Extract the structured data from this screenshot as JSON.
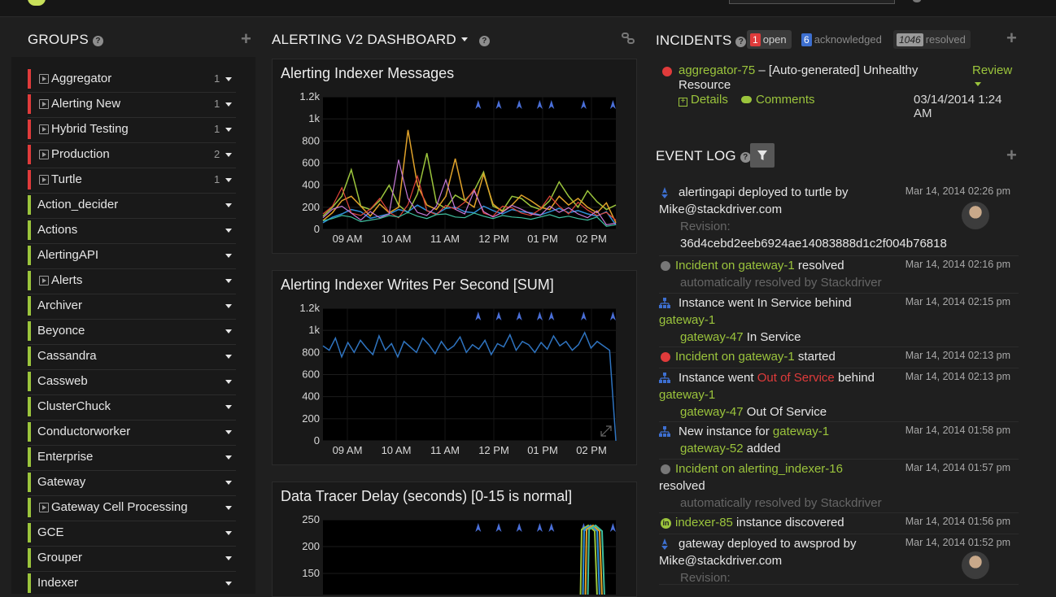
{
  "colors": {
    "accent_green": "#9bc43c",
    "alert_red": "#e03b3b",
    "chart_blue": "#2f74c0",
    "bg": "#1f1f1f"
  },
  "groups": {
    "title": "GROUPS",
    "items": [
      {
        "label": "Aggregator",
        "count": "1",
        "status": "red",
        "has_play": true
      },
      {
        "label": "Alerting New",
        "count": "1",
        "status": "red",
        "has_play": true
      },
      {
        "label": "Hybrid Testing",
        "count": "1",
        "status": "red",
        "has_play": true
      },
      {
        "label": "Production",
        "count": "2",
        "status": "red",
        "has_play": true
      },
      {
        "label": "Turtle",
        "count": "1",
        "status": "red",
        "has_play": true
      },
      {
        "label": "Action_decider",
        "count": "",
        "status": "green",
        "has_play": false
      },
      {
        "label": "Actions",
        "count": "",
        "status": "green",
        "has_play": false
      },
      {
        "label": "AlertingAPI",
        "count": "",
        "status": "green",
        "has_play": false
      },
      {
        "label": "Alerts",
        "count": "",
        "status": "green",
        "has_play": true
      },
      {
        "label": "Archiver",
        "count": "",
        "status": "green",
        "has_play": false
      },
      {
        "label": "Beyonce",
        "count": "",
        "status": "green",
        "has_play": false
      },
      {
        "label": "Cassandra",
        "count": "",
        "status": "green",
        "has_play": false
      },
      {
        "label": "Cassweb",
        "count": "",
        "status": "green",
        "has_play": false
      },
      {
        "label": "ClusterChuck",
        "count": "",
        "status": "green",
        "has_play": false
      },
      {
        "label": "Conductorworker",
        "count": "",
        "status": "green",
        "has_play": false
      },
      {
        "label": "Enterprise",
        "count": "",
        "status": "green",
        "has_play": false
      },
      {
        "label": "Gateway",
        "count": "",
        "status": "green",
        "has_play": false
      },
      {
        "label": "Gateway Cell Processing",
        "count": "",
        "status": "green",
        "has_play": true
      },
      {
        "label": "GCE",
        "count": "",
        "status": "green",
        "has_play": false
      },
      {
        "label": "Grouper",
        "count": "",
        "status": "green",
        "has_play": false
      },
      {
        "label": "Indexer",
        "count": "",
        "status": "green",
        "has_play": false
      }
    ]
  },
  "dashboard": {
    "title": "ALERTING V2 DASHBOARD",
    "charts": [
      {
        "title": "Alerting Indexer Messages"
      },
      {
        "title": "Alerting Indexer Writes Per Second [SUM]"
      },
      {
        "title": "Data Tracer Delay (seconds) [0-15 is normal]"
      }
    ]
  },
  "chart_data": [
    {
      "type": "line",
      "title": "Alerting Indexer Messages",
      "stacked_multicolor": true,
      "x": [
        "09 AM",
        "10 AM",
        "11 AM",
        "12 PM",
        "01 PM",
        "02 PM"
      ],
      "yticks": [
        "1.2k",
        "1k",
        "800",
        "600",
        "400",
        "200",
        "0"
      ],
      "ylim": [
        0,
        1200
      ],
      "series_colors": [
        "#9bc43c",
        "#e0a22a",
        "#2f8fd8",
        "#e0443a",
        "#c77ad8",
        "#3fbf9f"
      ],
      "series": [
        {
          "values": [
            120,
            200,
            300,
            540,
            210,
            180,
            260,
            400,
            220,
            150,
            320,
            690,
            240,
            190,
            310,
            260,
            350,
            520,
            210,
            170,
            300,
            280,
            210,
            180,
            260,
            430,
            300,
            200,
            350,
            250,
            180,
            220
          ]
        },
        {
          "values": [
            80,
            150,
            260,
            300,
            210,
            120,
            230,
            150,
            200,
            900,
            400,
            220,
            180,
            300,
            640,
            260,
            200,
            500,
            230,
            160,
            220,
            310,
            260,
            200,
            180,
            300,
            220,
            280,
            200,
            150,
            240,
            60
          ]
        },
        {
          "values": [
            60,
            110,
            140,
            180,
            160,
            100,
            120,
            140,
            180,
            160,
            220,
            170,
            140,
            190,
            200,
            160,
            150,
            210,
            170,
            140,
            180,
            160,
            150,
            130,
            160,
            190,
            150,
            170,
            140,
            120,
            160,
            40
          ]
        }
      ],
      "markers_x_fraction": [
        0.53,
        0.6,
        0.67,
        0.74,
        0.78,
        0.89,
        0.99
      ]
    },
    {
      "type": "line",
      "title": "Alerting Indexer Writes Per Second [SUM]",
      "x": [
        "09 AM",
        "10 AM",
        "11 AM",
        "12 PM",
        "01 PM",
        "02 PM"
      ],
      "yticks": [
        "1.2k",
        "1k",
        "800",
        "600",
        "400",
        "200",
        "0"
      ],
      "ylim": [
        0,
        1200
      ],
      "series": [
        {
          "color": "#2f74c0",
          "values": [
            860,
            820,
            930,
            760,
            890,
            800,
            910,
            840,
            780,
            950,
            820,
            880,
            760,
            900,
            850,
            800,
            930,
            870,
            790,
            900,
            820,
            860,
            940,
            800,
            870,
            830,
            910,
            780,
            880,
            850,
            960,
            820,
            900,
            870,
            800,
            890,
            830,
            950,
            860,
            900,
            820,
            870,
            980,
            840,
            900,
            860,
            820,
            0
          ]
        }
      ],
      "markers_x_fraction": [
        0.53,
        0.6,
        0.67,
        0.74,
        0.78,
        0.89,
        0.99
      ]
    },
    {
      "type": "line",
      "title": "Data Tracer Delay (seconds) [0-15 is normal]",
      "yticks": [
        "250",
        "200",
        "150"
      ],
      "ylim": [
        0,
        250
      ],
      "markers_x_fraction": [
        0.53,
        0.6,
        0.67,
        0.74,
        0.78,
        0.89,
        0.99
      ]
    }
  ],
  "incidents": {
    "title": "INCIDENTS",
    "open_count": "1",
    "open_label": "open",
    "ack_count": "6",
    "ack_label": "acknowledged",
    "resolved_count": "1046",
    "resolved_label": "resolved",
    "item": {
      "name": "aggregator-75",
      "text": " – [Auto-generated] Unhealthy Resource",
      "review": "Review",
      "details": "Details",
      "comments": "Comments",
      "date": "03/14/2014 1:24 AM"
    }
  },
  "event_log": {
    "title": "EVENT LOG",
    "events": [
      {
        "icon": "deploy-icon",
        "time": "Mar 14, 2014 02:26 pm",
        "l1": "alertingapi deployed to turtle by",
        "l2": "Mike@stackdriver.com",
        "l3": "Revision:",
        "l4": "36d4cebd2eeb6924ae14083888d1c2f004b76818"
      },
      {
        "icon": "resolved-dot-icon",
        "time": "Mar 14, 2014 02:16 pm",
        "link": "Incident on gateway-1",
        "after": " resolved",
        "sub": "automatically resolved by Stackdriver"
      },
      {
        "icon": "instance-icon",
        "time": "Mar 14, 2014 02:15 pm",
        "pre": "Instance went In Service behind",
        "link": "gateway-1",
        "sub_link": "gateway-47",
        "sub_after": " In Service"
      },
      {
        "icon": "incident-dot-icon",
        "time": "Mar 14, 2014 02:13 pm",
        "link": "Incident on gateway-1",
        "after": " started"
      },
      {
        "icon": "instance-icon",
        "time": "Mar 14, 2014 02:13 pm",
        "pre": "Instance went ",
        "red": "Out of Service",
        "post": " behind",
        "link": "gateway-1",
        "sub_link": "gateway-47",
        "sub_after": " Out Of Service"
      },
      {
        "icon": "instance-icon",
        "time": "Mar 14, 2014 01:58 pm",
        "pre": "New instance for ",
        "link": "gateway-1",
        "sub_link": "gateway-52",
        "sub_after": " added"
      },
      {
        "icon": "resolved-dot-icon",
        "time": "Mar 14, 2014 01:57 pm",
        "link": "Incident on alerting_indexer-16",
        "l2": "resolved",
        "sub": "automatically resolved by Stackdriver"
      },
      {
        "icon": "discover-icon",
        "time": "Mar 14, 2014 01:56 pm",
        "link": "indexer-85",
        "after": " instance discovered"
      },
      {
        "icon": "deploy-icon",
        "time": "Mar 14, 2014 01:52 pm",
        "l1": "gateway deployed to awsprod by",
        "l2": "Mike@stackdriver.com",
        "l3": "Revision:"
      }
    ]
  }
}
